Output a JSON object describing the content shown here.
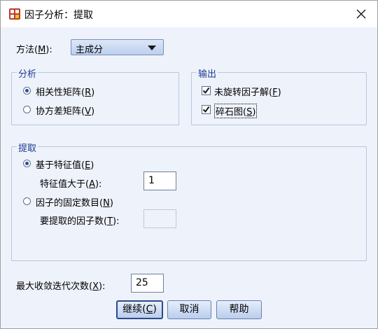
{
  "window": {
    "title": "因子分析：提取"
  },
  "method": {
    "label": "方法(",
    "key": "M",
    "suffix": "):",
    "selected": "主成分"
  },
  "analysis": {
    "legend": "分析",
    "correlation": {
      "label": "相关性矩阵(",
      "key": "R",
      "suffix": ")",
      "selected": true
    },
    "covariance": {
      "label": "协方差矩阵(",
      "key": "V",
      "suffix": ")",
      "selected": false
    }
  },
  "output": {
    "legend": "输出",
    "unrotated": {
      "label": "未旋转因子解(",
      "key": "F",
      "suffix": ")",
      "checked": true
    },
    "scree": {
      "label": "碎石图(",
      "key": "S",
      "suffix": ")",
      "checked": true
    }
  },
  "extract": {
    "legend": "提取",
    "eigen_option": {
      "label": "基于特征值(",
      "key": "E",
      "suffix": ")",
      "selected": true
    },
    "eigen_gt": {
      "label": "特征值大于(",
      "key": "A",
      "suffix": "):",
      "value": "1"
    },
    "fixed_option": {
      "label": "因子的固定数目(",
      "key": "N",
      "suffix": ")",
      "selected": false
    },
    "num_factors": {
      "label": "要提取的因子数(",
      "key": "T",
      "suffix": "):",
      "value": ""
    }
  },
  "max_iter": {
    "label": "最大收敛迭代次数(",
    "key": "X",
    "suffix": "):",
    "value": "25"
  },
  "buttons": {
    "continue": {
      "label": "继续(",
      "key": "C",
      "suffix": ")"
    },
    "cancel": "取消",
    "help": "帮助"
  }
}
